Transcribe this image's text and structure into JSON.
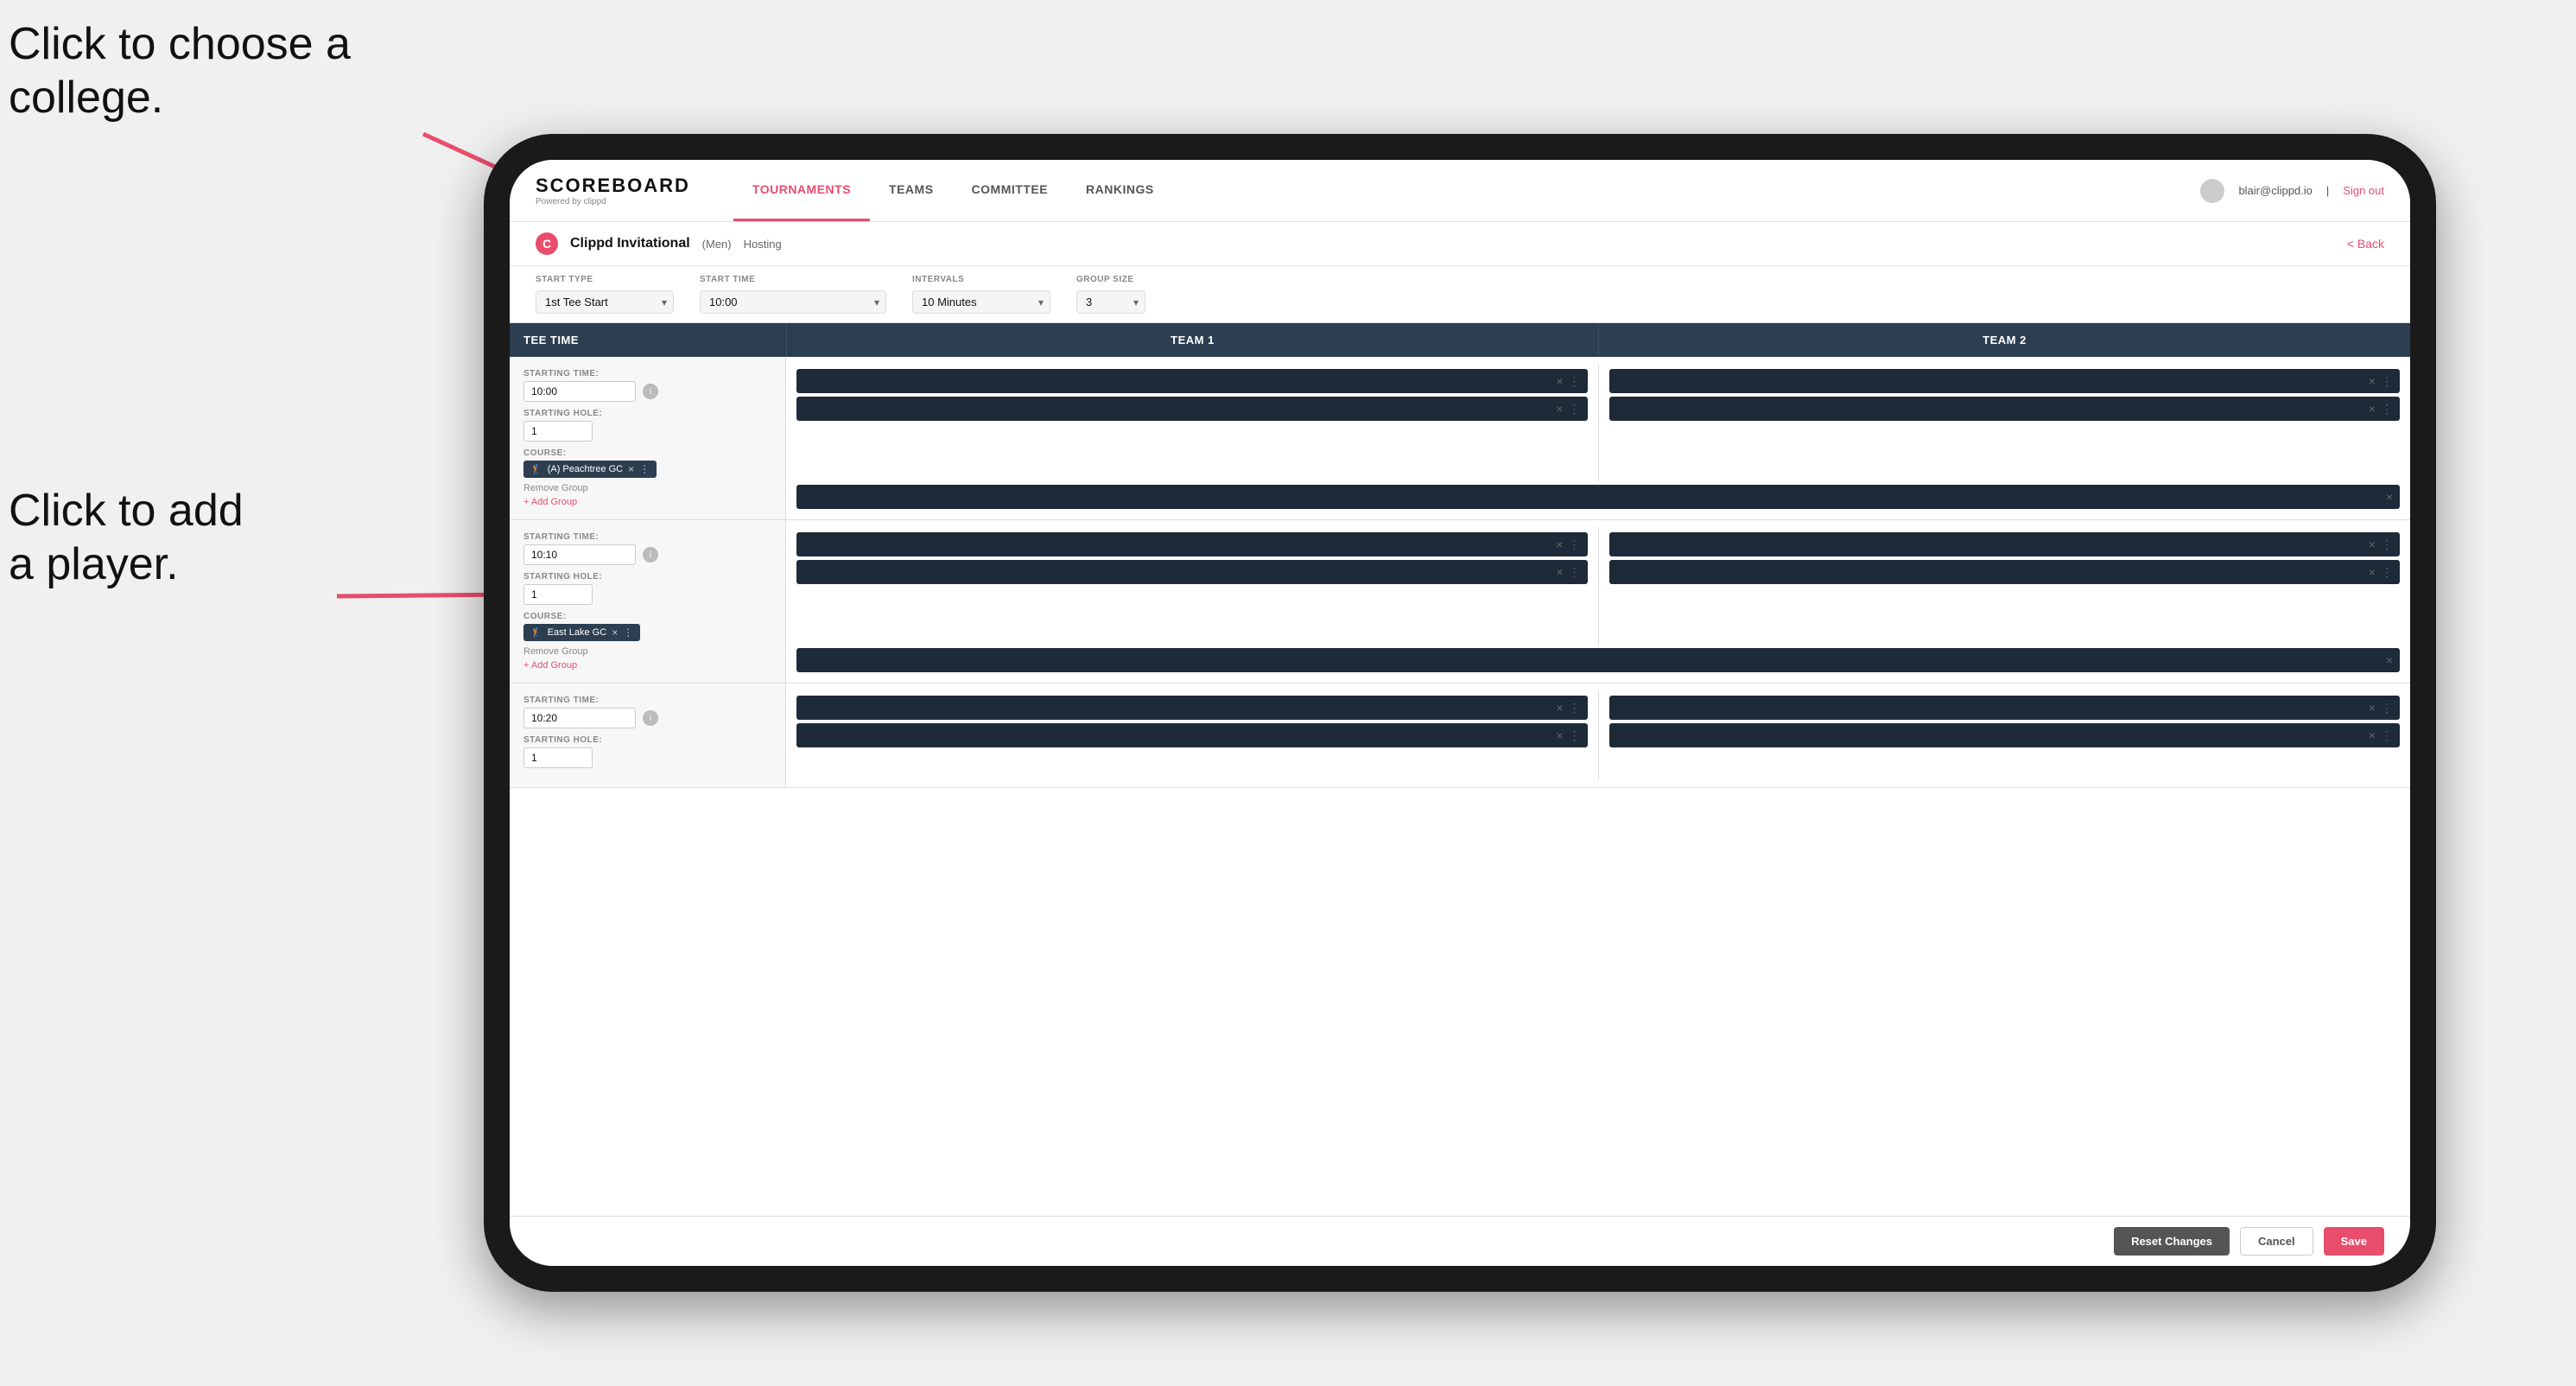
{
  "annotations": {
    "text1_line1": "Click to choose a",
    "text1_line2": "college.",
    "text2_line1": "Click to add",
    "text2_line2": "a player."
  },
  "header": {
    "brand": "SCOREBOARD",
    "brand_sub": "Powered by clippd",
    "nav": [
      {
        "label": "TOURNAMENTS",
        "active": true
      },
      {
        "label": "TEAMS",
        "active": false
      },
      {
        "label": "COMMITTEE",
        "active": false
      },
      {
        "label": "RANKINGS",
        "active": false
      }
    ],
    "user_email": "blair@clippd.io",
    "sign_out": "Sign out"
  },
  "subheader": {
    "title": "Clippd Invitational",
    "badge": "(Men)",
    "hosting": "Hosting",
    "back": "< Back"
  },
  "settings": {
    "start_type_label": "Start Type",
    "start_type_value": "1st Tee Start",
    "start_time_label": "Start Time",
    "start_time_value": "10:00",
    "intervals_label": "Intervals",
    "intervals_value": "10 Minutes",
    "group_size_label": "Group Size",
    "group_size_value": "3"
  },
  "table": {
    "col_tee": "Tee Time",
    "col_team1": "Team 1",
    "col_team2": "Team 2"
  },
  "groups": [
    {
      "id": 1,
      "starting_time": "10:00",
      "starting_hole": "1",
      "course": "(A) Peachtree GC",
      "players_team1": [
        "",
        ""
      ],
      "players_team2": [
        "",
        ""
      ]
    },
    {
      "id": 2,
      "starting_time": "10:10",
      "starting_hole": "1",
      "course": "East Lake GC",
      "players_team1": [
        "",
        ""
      ],
      "players_team2": [
        "",
        ""
      ]
    },
    {
      "id": 3,
      "starting_time": "10:20",
      "starting_hole": "1",
      "course": "",
      "players_team1": [
        "",
        ""
      ],
      "players_team2": [
        "",
        ""
      ]
    }
  ],
  "actions": {
    "remove_group": "Remove Group",
    "add_group": "+ Add Group",
    "reset": "Reset Changes",
    "cancel": "Cancel",
    "save": "Save"
  }
}
